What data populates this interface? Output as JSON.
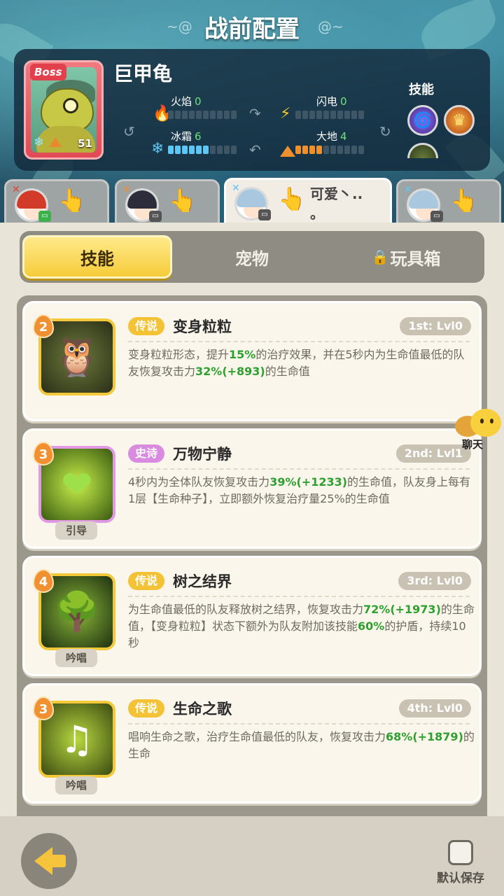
{
  "header": {
    "title": "战前配置"
  },
  "boss": {
    "badge": "Boss",
    "name": "巨甲龟",
    "level": "51",
    "stats": {
      "fire": {
        "label": "火焰",
        "value": "0",
        "fill": 0
      },
      "lightning": {
        "label": "闪电",
        "value": "0",
        "fill": 0
      },
      "ice": {
        "label": "冰霜",
        "value": "6",
        "fill": 6
      },
      "earth": {
        "label": "大地",
        "value": "4",
        "fill": 4
      }
    },
    "skills_label": "技能"
  },
  "team_tabs": [
    {
      "state": "inactive"
    },
    {
      "state": "inactive"
    },
    {
      "state": "active",
      "bubble_text": "可爱丶.. 。"
    },
    {
      "state": "inactive"
    }
  ],
  "segment": {
    "skills": "技能",
    "pets": "宠物",
    "toybox": "玩具箱"
  },
  "skills": [
    {
      "num": "2",
      "rarity": "传说",
      "rarity_kind": "legend",
      "name": "变身粒粒",
      "order": "1st: Lvl0",
      "type": "",
      "desc": [
        "变身粒粒形态，提升",
        "15%",
        "的治疗效果，并在5秒内为生命值最低的队友恢复攻击力",
        "32%(+893)",
        "的生命值"
      ]
    },
    {
      "num": "3",
      "rarity": "史诗",
      "rarity_kind": "epic",
      "name": "万物宁静",
      "order": "2nd: Lvl1",
      "type": "引导",
      "desc": [
        "4秒内为全体队友恢复攻击力",
        "39%(+1233)",
        "的生命值，队友身上每有1层【生命种子】，立即额外恢复治疗量25%的生命值",
        "",
        ""
      ]
    },
    {
      "num": "4",
      "rarity": "传说",
      "rarity_kind": "legend",
      "name": "树之结界",
      "order": "3rd: Lvl0",
      "type": "吟唱",
      "desc": [
        "为生命值最低的队友释放树之结界，恢复攻击力",
        "72%(+1973)",
        "的生命值，【变身粒粒】状态下额外为队友附加该技能",
        "60%",
        "的护盾，持续10秒"
      ]
    },
    {
      "num": "3",
      "rarity": "传说",
      "rarity_kind": "legend",
      "name": "生命之歌",
      "order": "4th: Lvl0",
      "type": "吟唱",
      "desc": [
        "唱响生命之歌，治疗生命值最低的队友，恢复攻击力",
        "68%(+1879)",
        "的生命",
        "",
        ""
      ]
    }
  ],
  "chat": {
    "label": "聊天"
  },
  "footer": {
    "save_label": "默认保存"
  },
  "colors": {
    "accent": "#f6cc3a",
    "green_value": "#2ea02f",
    "epic": "#d98be0"
  }
}
